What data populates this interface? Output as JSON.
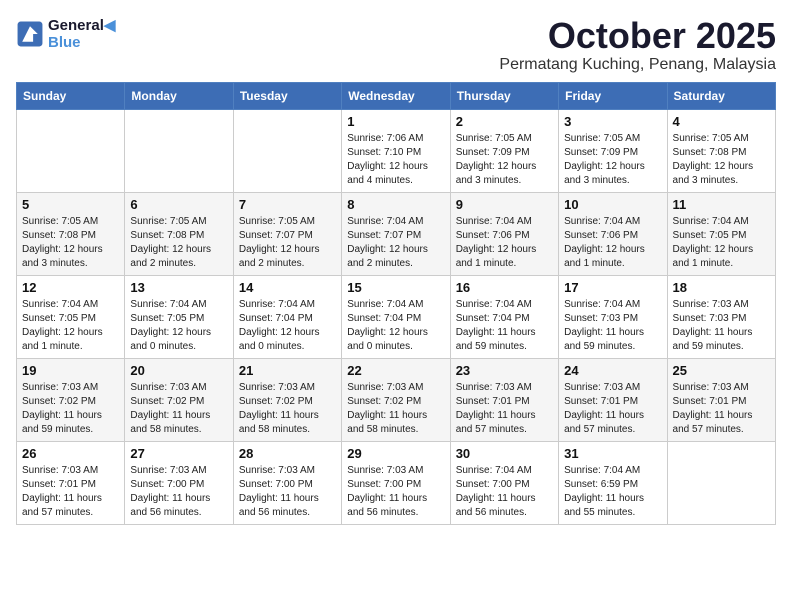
{
  "header": {
    "logo_line1": "General",
    "logo_line2": "Blue",
    "month_title": "October 2025",
    "location": "Permatang Kuching, Penang, Malaysia"
  },
  "days_of_week": [
    "Sunday",
    "Monday",
    "Tuesday",
    "Wednesday",
    "Thursday",
    "Friday",
    "Saturday"
  ],
  "weeks": [
    [
      {
        "day": "",
        "info": ""
      },
      {
        "day": "",
        "info": ""
      },
      {
        "day": "",
        "info": ""
      },
      {
        "day": "1",
        "info": "Sunrise: 7:06 AM\nSunset: 7:10 PM\nDaylight: 12 hours and 4 minutes."
      },
      {
        "day": "2",
        "info": "Sunrise: 7:05 AM\nSunset: 7:09 PM\nDaylight: 12 hours and 3 minutes."
      },
      {
        "day": "3",
        "info": "Sunrise: 7:05 AM\nSunset: 7:09 PM\nDaylight: 12 hours and 3 minutes."
      },
      {
        "day": "4",
        "info": "Sunrise: 7:05 AM\nSunset: 7:08 PM\nDaylight: 12 hours and 3 minutes."
      }
    ],
    [
      {
        "day": "5",
        "info": "Sunrise: 7:05 AM\nSunset: 7:08 PM\nDaylight: 12 hours and 3 minutes."
      },
      {
        "day": "6",
        "info": "Sunrise: 7:05 AM\nSunset: 7:08 PM\nDaylight: 12 hours and 2 minutes."
      },
      {
        "day": "7",
        "info": "Sunrise: 7:05 AM\nSunset: 7:07 PM\nDaylight: 12 hours and 2 minutes."
      },
      {
        "day": "8",
        "info": "Sunrise: 7:04 AM\nSunset: 7:07 PM\nDaylight: 12 hours and 2 minutes."
      },
      {
        "day": "9",
        "info": "Sunrise: 7:04 AM\nSunset: 7:06 PM\nDaylight: 12 hours and 1 minute."
      },
      {
        "day": "10",
        "info": "Sunrise: 7:04 AM\nSunset: 7:06 PM\nDaylight: 12 hours and 1 minute."
      },
      {
        "day": "11",
        "info": "Sunrise: 7:04 AM\nSunset: 7:05 PM\nDaylight: 12 hours and 1 minute."
      }
    ],
    [
      {
        "day": "12",
        "info": "Sunrise: 7:04 AM\nSunset: 7:05 PM\nDaylight: 12 hours and 1 minute."
      },
      {
        "day": "13",
        "info": "Sunrise: 7:04 AM\nSunset: 7:05 PM\nDaylight: 12 hours and 0 minutes."
      },
      {
        "day": "14",
        "info": "Sunrise: 7:04 AM\nSunset: 7:04 PM\nDaylight: 12 hours and 0 minutes."
      },
      {
        "day": "15",
        "info": "Sunrise: 7:04 AM\nSunset: 7:04 PM\nDaylight: 12 hours and 0 minutes."
      },
      {
        "day": "16",
        "info": "Sunrise: 7:04 AM\nSunset: 7:04 PM\nDaylight: 11 hours and 59 minutes."
      },
      {
        "day": "17",
        "info": "Sunrise: 7:04 AM\nSunset: 7:03 PM\nDaylight: 11 hours and 59 minutes."
      },
      {
        "day": "18",
        "info": "Sunrise: 7:03 AM\nSunset: 7:03 PM\nDaylight: 11 hours and 59 minutes."
      }
    ],
    [
      {
        "day": "19",
        "info": "Sunrise: 7:03 AM\nSunset: 7:02 PM\nDaylight: 11 hours and 59 minutes."
      },
      {
        "day": "20",
        "info": "Sunrise: 7:03 AM\nSunset: 7:02 PM\nDaylight: 11 hours and 58 minutes."
      },
      {
        "day": "21",
        "info": "Sunrise: 7:03 AM\nSunset: 7:02 PM\nDaylight: 11 hours and 58 minutes."
      },
      {
        "day": "22",
        "info": "Sunrise: 7:03 AM\nSunset: 7:02 PM\nDaylight: 11 hours and 58 minutes."
      },
      {
        "day": "23",
        "info": "Sunrise: 7:03 AM\nSunset: 7:01 PM\nDaylight: 11 hours and 57 minutes."
      },
      {
        "day": "24",
        "info": "Sunrise: 7:03 AM\nSunset: 7:01 PM\nDaylight: 11 hours and 57 minutes."
      },
      {
        "day": "25",
        "info": "Sunrise: 7:03 AM\nSunset: 7:01 PM\nDaylight: 11 hours and 57 minutes."
      }
    ],
    [
      {
        "day": "26",
        "info": "Sunrise: 7:03 AM\nSunset: 7:01 PM\nDaylight: 11 hours and 57 minutes."
      },
      {
        "day": "27",
        "info": "Sunrise: 7:03 AM\nSunset: 7:00 PM\nDaylight: 11 hours and 56 minutes."
      },
      {
        "day": "28",
        "info": "Sunrise: 7:03 AM\nSunset: 7:00 PM\nDaylight: 11 hours and 56 minutes."
      },
      {
        "day": "29",
        "info": "Sunrise: 7:03 AM\nSunset: 7:00 PM\nDaylight: 11 hours and 56 minutes."
      },
      {
        "day": "30",
        "info": "Sunrise: 7:04 AM\nSunset: 7:00 PM\nDaylight: 11 hours and 56 minutes."
      },
      {
        "day": "31",
        "info": "Sunrise: 7:04 AM\nSunset: 6:59 PM\nDaylight: 11 hours and 55 minutes."
      },
      {
        "day": "",
        "info": ""
      }
    ]
  ]
}
